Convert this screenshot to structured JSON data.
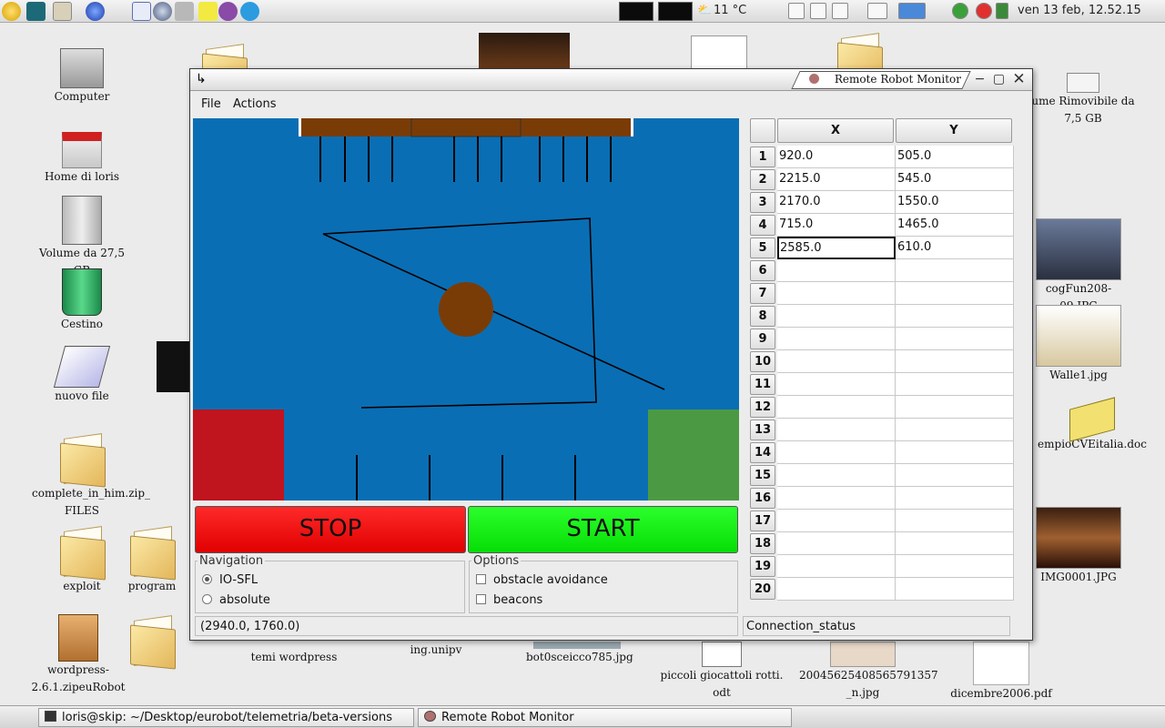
{
  "top_panel": {
    "launchers": [
      "gnome-foot-icon",
      "monitor-app-icon",
      "files-icon",
      "web-browser-icon",
      "text-editor-icon",
      "globe-icon",
      "folder-icon",
      "notes-icon",
      "chat-icon",
      "skype-icon"
    ],
    "weather": "11 °C",
    "clock": "ven 13 feb, 12.52.15"
  },
  "desktop_icons": [
    {
      "label": "Computer",
      "icon": "computer-icon"
    },
    {
      "label": "Home di loris",
      "icon": "home-icon"
    },
    {
      "label": "Volume da 27,5 GB",
      "icon": "drive-icon"
    },
    {
      "label": "Cestino",
      "icon": "trash-icon"
    },
    {
      "label": "nuovo file",
      "icon": "paper-icon"
    },
    {
      "label": "complete_in_him.zip_ FILES",
      "icon": "folder-icon"
    },
    {
      "label": "exploit",
      "icon": "folder-icon"
    },
    {
      "label": "program",
      "icon": "folder-icon"
    },
    {
      "label": "wordpress-2.6.1.zipeuRobot",
      "icon": "zip-icon"
    },
    {
      "label": "temi wordpress",
      "icon": "folder-icon"
    },
    {
      "label": "ing.unipv",
      "icon": "folder-icon"
    },
    {
      "label": "bot0sceicco785.jpg",
      "icon": "image-icon"
    },
    {
      "label": "piccoli giocattoli rotti. odt",
      "icon": "document-icon"
    },
    {
      "label": "20045625408565791357 _n.jpg",
      "icon": "image-icon"
    },
    {
      "label": "dicembre2006.pdf",
      "icon": "pdf-icon"
    },
    {
      "label": "ume Rimovibile da 7,5 GB",
      "icon": "removable-drive-icon"
    },
    {
      "label": "cogFun208-09.JPG",
      "icon": "photo-icon"
    },
    {
      "label": "Walle1.jpg",
      "icon": "photo-icon"
    },
    {
      "label": "empioCVEitalia.doc",
      "icon": "doc-icon"
    },
    {
      "label": "IMG0001.JPG",
      "icon": "photo-icon"
    }
  ],
  "window": {
    "title": "Remote Robot Monitor",
    "controls": [
      "minimize",
      "maximize",
      "close"
    ]
  },
  "menu": {
    "file": "File",
    "actions": "Actions"
  },
  "field": {
    "colors": {
      "background": "#0a6eb4",
      "wall": "#7a3c06",
      "robot": "#7a3c06",
      "red_zone": "#c0141e",
      "green_zone": "#4b9a43"
    }
  },
  "buttons": {
    "stop": "STOP",
    "start": "START"
  },
  "navigation": {
    "title": "Navigation",
    "options": [
      {
        "label": "IO-SFL",
        "selected": true
      },
      {
        "label": "absolute",
        "selected": false
      }
    ]
  },
  "options": {
    "title": "Options",
    "items": [
      {
        "label": "obstacle avoidance",
        "checked": false
      },
      {
        "label": "beacons",
        "checked": false
      }
    ]
  },
  "status": {
    "coords": "(2940.0, 1760.0)",
    "connection": "Connection_status"
  },
  "table": {
    "columns": [
      "X",
      "Y"
    ],
    "rows": [
      {
        "num": "1",
        "x": "920.0",
        "y": "505.0"
      },
      {
        "num": "2",
        "x": "2215.0",
        "y": "545.0"
      },
      {
        "num": "3",
        "x": "2170.0",
        "y": "1550.0"
      },
      {
        "num": "4",
        "x": "715.0",
        "y": "1465.0"
      },
      {
        "num": "5",
        "x": "2585.0",
        "y": "610.0"
      },
      {
        "num": "6",
        "x": "",
        "y": ""
      },
      {
        "num": "7",
        "x": "",
        "y": ""
      },
      {
        "num": "8",
        "x": "",
        "y": ""
      },
      {
        "num": "9",
        "x": "",
        "y": ""
      },
      {
        "num": "10",
        "x": "",
        "y": ""
      },
      {
        "num": "11",
        "x": "",
        "y": ""
      },
      {
        "num": "12",
        "x": "",
        "y": ""
      },
      {
        "num": "13",
        "x": "",
        "y": ""
      },
      {
        "num": "14",
        "x": "",
        "y": ""
      },
      {
        "num": "15",
        "x": "",
        "y": ""
      },
      {
        "num": "16",
        "x": "",
        "y": ""
      },
      {
        "num": "17",
        "x": "",
        "y": ""
      },
      {
        "num": "18",
        "x": "",
        "y": ""
      },
      {
        "num": "19",
        "x": "",
        "y": ""
      },
      {
        "num": "20",
        "x": "",
        "y": ""
      }
    ]
  },
  "taskbar": {
    "items": [
      "loris@skip: ~/Desktop/eurobot/telemetria/beta-versions",
      "Remote Robot Monitor"
    ]
  }
}
